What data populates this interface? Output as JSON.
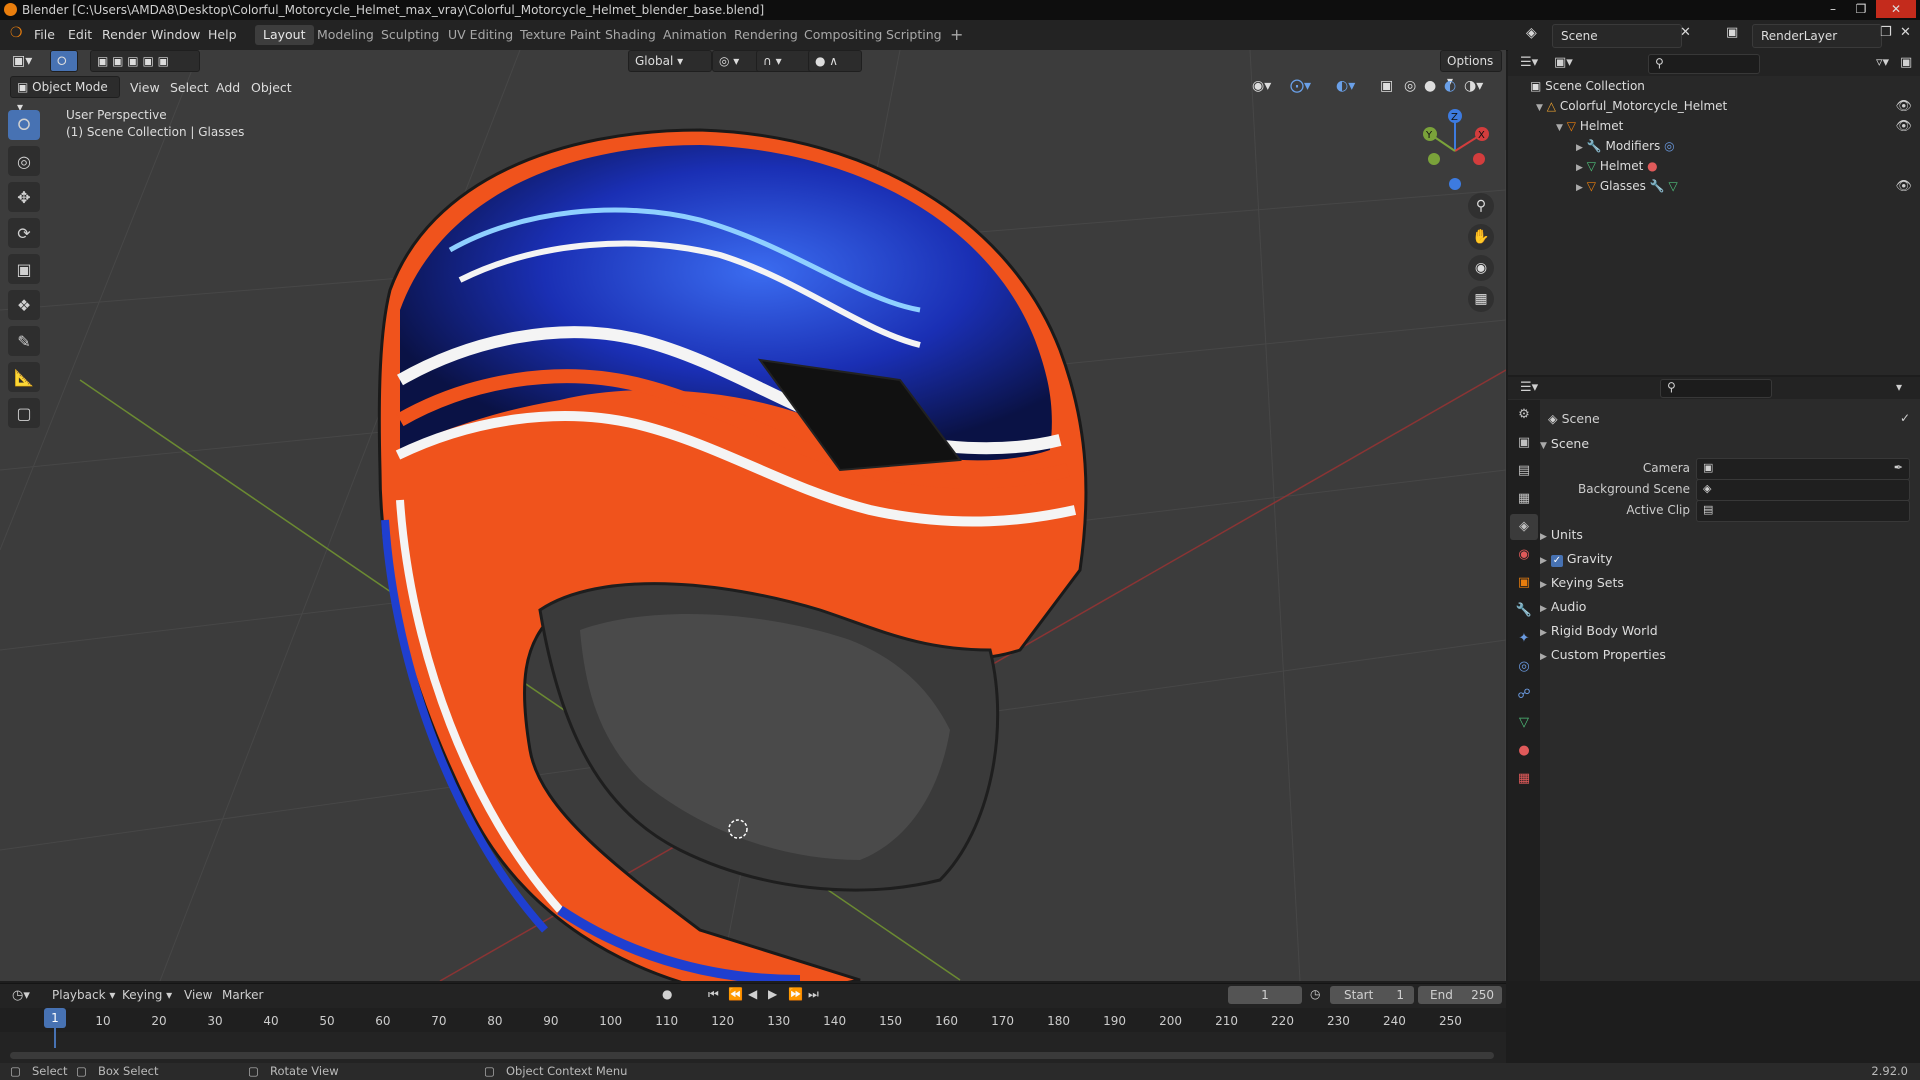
{
  "window": {
    "title": "Blender [C:\\Users\\AMDA8\\Desktop\\Colorful_Motorcycle_Helmet_max_vray\\Colorful_Motorcycle_Helmet_blender_base.blend]"
  },
  "menu": [
    "File",
    "Edit",
    "Render",
    "Window",
    "Help"
  ],
  "workspaces": [
    "Layout",
    "Modeling",
    "Sculpting",
    "UV Editing",
    "Texture Paint",
    "Shading",
    "Animation",
    "Rendering",
    "Compositing",
    "Scripting"
  ],
  "workspace_add": "+",
  "scene_name": "Scene",
  "view_layer": "RenderLayer",
  "viewport": {
    "mode": "Object Mode",
    "menus": [
      "View",
      "Select",
      "Add",
      "Object"
    ],
    "transform": "Global",
    "options": "Options",
    "overlay_line1": "User Perspective",
    "overlay_line2": "(1) Scene Collection | Glasses",
    "gizmo": {
      "x": "X",
      "y": "Y",
      "z": "Z"
    }
  },
  "outliner": {
    "root": "Scene Collection",
    "items": [
      {
        "label": "Colorful_Motorcycle_Helmet"
      },
      {
        "label": "Helmet"
      },
      {
        "label": "Modifiers"
      },
      {
        "label": "Helmet"
      },
      {
        "label": "Glasses"
      }
    ]
  },
  "properties": {
    "context": "Scene",
    "panel": "Scene",
    "fields": [
      {
        "label": "Camera"
      },
      {
        "label": "Background Scene"
      },
      {
        "label": "Active Clip"
      }
    ],
    "sections": [
      "Units",
      "Gravity",
      "Keying Sets",
      "Audio",
      "Rigid Body World",
      "Custom Properties"
    ],
    "gravity_checked": true
  },
  "timeline": {
    "menus": [
      "Playback",
      "Keying",
      "View",
      "Marker"
    ],
    "current_frame": "1",
    "start_label": "Start",
    "start": "1",
    "end_label": "End",
    "end": "250",
    "ticks": [
      "1",
      "10",
      "20",
      "30",
      "40",
      "50",
      "60",
      "70",
      "80",
      "90",
      "100",
      "110",
      "120",
      "130",
      "140",
      "150",
      "160",
      "170",
      "180",
      "190",
      "200",
      "210",
      "220",
      "230",
      "240",
      "250"
    ]
  },
  "statusbar": {
    "select": "Select",
    "box_select": "Box Select",
    "rotate": "Rotate View",
    "context_menu": "Object Context Menu",
    "version": "2.92.0"
  },
  "colors": {
    "accent": "#4772b3",
    "helmet_orange": "#f0531c",
    "helmet_blue": "#1f3fd0"
  }
}
